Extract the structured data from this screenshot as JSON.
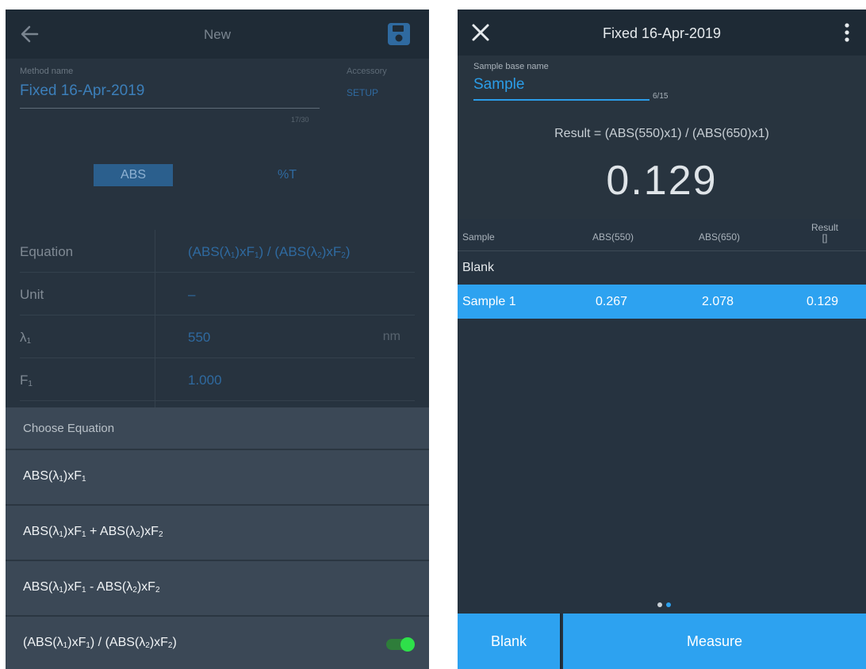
{
  "left": {
    "title": "New",
    "method_label": "Method name",
    "method_value": "Fixed 16-Apr-2019",
    "method_count": "17/30",
    "accessory_label": "Accessory",
    "setup_label": "SETUP",
    "mode_abs": "ABS",
    "mode_pct_t": "%T",
    "rows": [
      {
        "label": "Equation",
        "value": "(ABS(λ1)xF1) / (ABS(λ2)xF2)"
      },
      {
        "label": "Unit",
        "value": "–"
      },
      {
        "label": "λ1",
        "value": "550",
        "unit": "nm"
      },
      {
        "label": "F1",
        "value": "1.000"
      }
    ],
    "chooser": {
      "title": "Choose Equation",
      "options": [
        "ABS(λ1)xF1",
        "ABS(λ1)xF1 + ABS(λ2)xF2",
        "ABS(λ1)xF1 - ABS(λ2)xF2",
        "(ABS(λ1)xF1) / (ABS(λ2)xF2)"
      ],
      "selected_index": 3
    },
    "colors": {
      "accent": "#2f6aa0",
      "toggle_on": "#2ee04a"
    }
  },
  "right": {
    "title": "Fixed 16-Apr-2019",
    "sample_label": "Sample base name",
    "sample_value": "Sample",
    "sample_count": "6/15",
    "formula": "Result = (ABS(550)x1) / (ABS(650)x1)",
    "big_result": "0.129",
    "table": {
      "headers": {
        "sample": "Sample",
        "abs550": "ABS(550)",
        "abs650": "ABS(650)",
        "result": "Result",
        "result_unit": "[]"
      },
      "blank_row": "Blank",
      "rows": [
        {
          "sample": "Sample 1",
          "abs550": "0.267",
          "abs650": "2.078",
          "result": "0.129"
        }
      ]
    },
    "buttons": {
      "blank": "Blank",
      "measure": "Measure"
    },
    "pager": {
      "pages": 2,
      "active": 1
    },
    "colors": {
      "accent": "#2da2f0",
      "background": "#263340"
    }
  }
}
